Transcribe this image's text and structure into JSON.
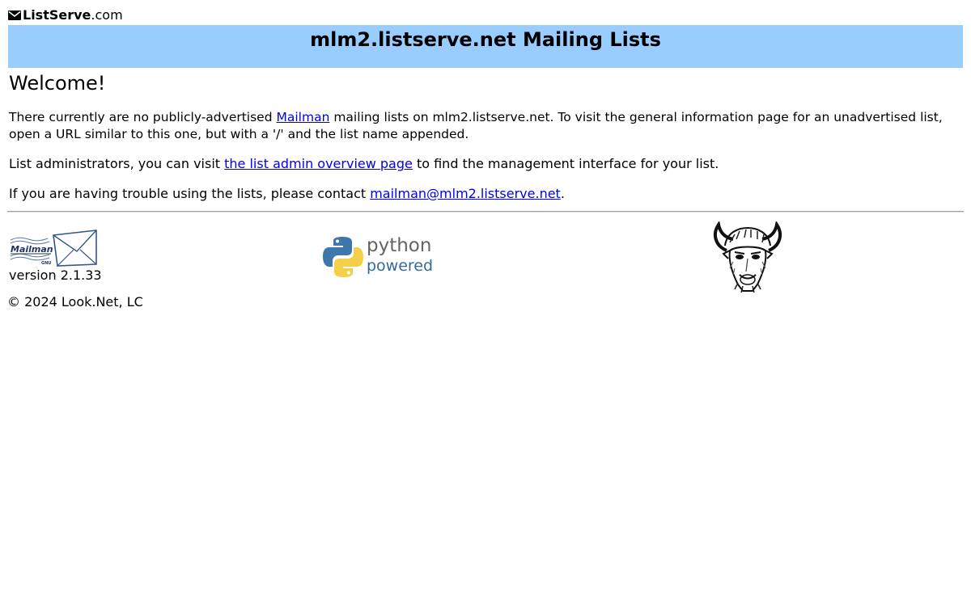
{
  "brand": {
    "name": "ListServe",
    "domain_suffix": ".com"
  },
  "header": {
    "title": "mlm2.listserve.net Mailing Lists",
    "background_color": "#99ccff"
  },
  "main": {
    "welcome": "Welcome!",
    "intro": {
      "before_link": "There currently are no publicly-advertised ",
      "link_label": "Mailman",
      "after_link": " mailing lists on mlm2.listserve.net. To visit the general information page for an unadvertised list, open a URL similar to this one, but with a '/' and the list name appended."
    },
    "admin": {
      "before_link": "List administrators, you can visit ",
      "link_label": "the list admin overview page",
      "after_link": " to find the management interface for your list."
    },
    "contact": {
      "before_link": "If you are having trouble using the lists, please contact ",
      "link_label": "mailman@mlm2.listserve.net",
      "after_link": "."
    },
    "link_color": "#0000ee"
  },
  "footer": {
    "mailman_logo": {
      "icon": "mailman-logo-icon",
      "text": "Mailman",
      "small_text": "GNU"
    },
    "version": "version 2.1.33",
    "python_logo": {
      "icon": "python-logo-icon",
      "word": "python",
      "sub": "powered"
    },
    "gnu_logo": {
      "icon": "gnu-head-icon"
    },
    "copyright": "© 2024 Look.Net, LC"
  }
}
